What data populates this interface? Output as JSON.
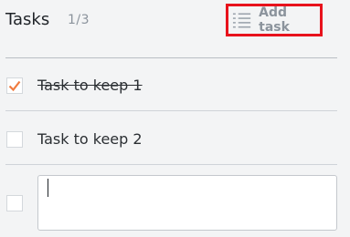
{
  "header": {
    "title": "Tasks",
    "count": "1/3",
    "add_task_label": "Add task",
    "add_task_icon": "list-icon",
    "highlight_color": "#e8121c"
  },
  "tasks": [
    {
      "label": "Task to keep 1",
      "checked": true
    },
    {
      "label": "Task to keep 2",
      "checked": false
    }
  ],
  "new_task": {
    "value": "",
    "checked": false
  },
  "colors": {
    "check_accent": "#f07b3f",
    "muted_text": "#8b939c"
  }
}
